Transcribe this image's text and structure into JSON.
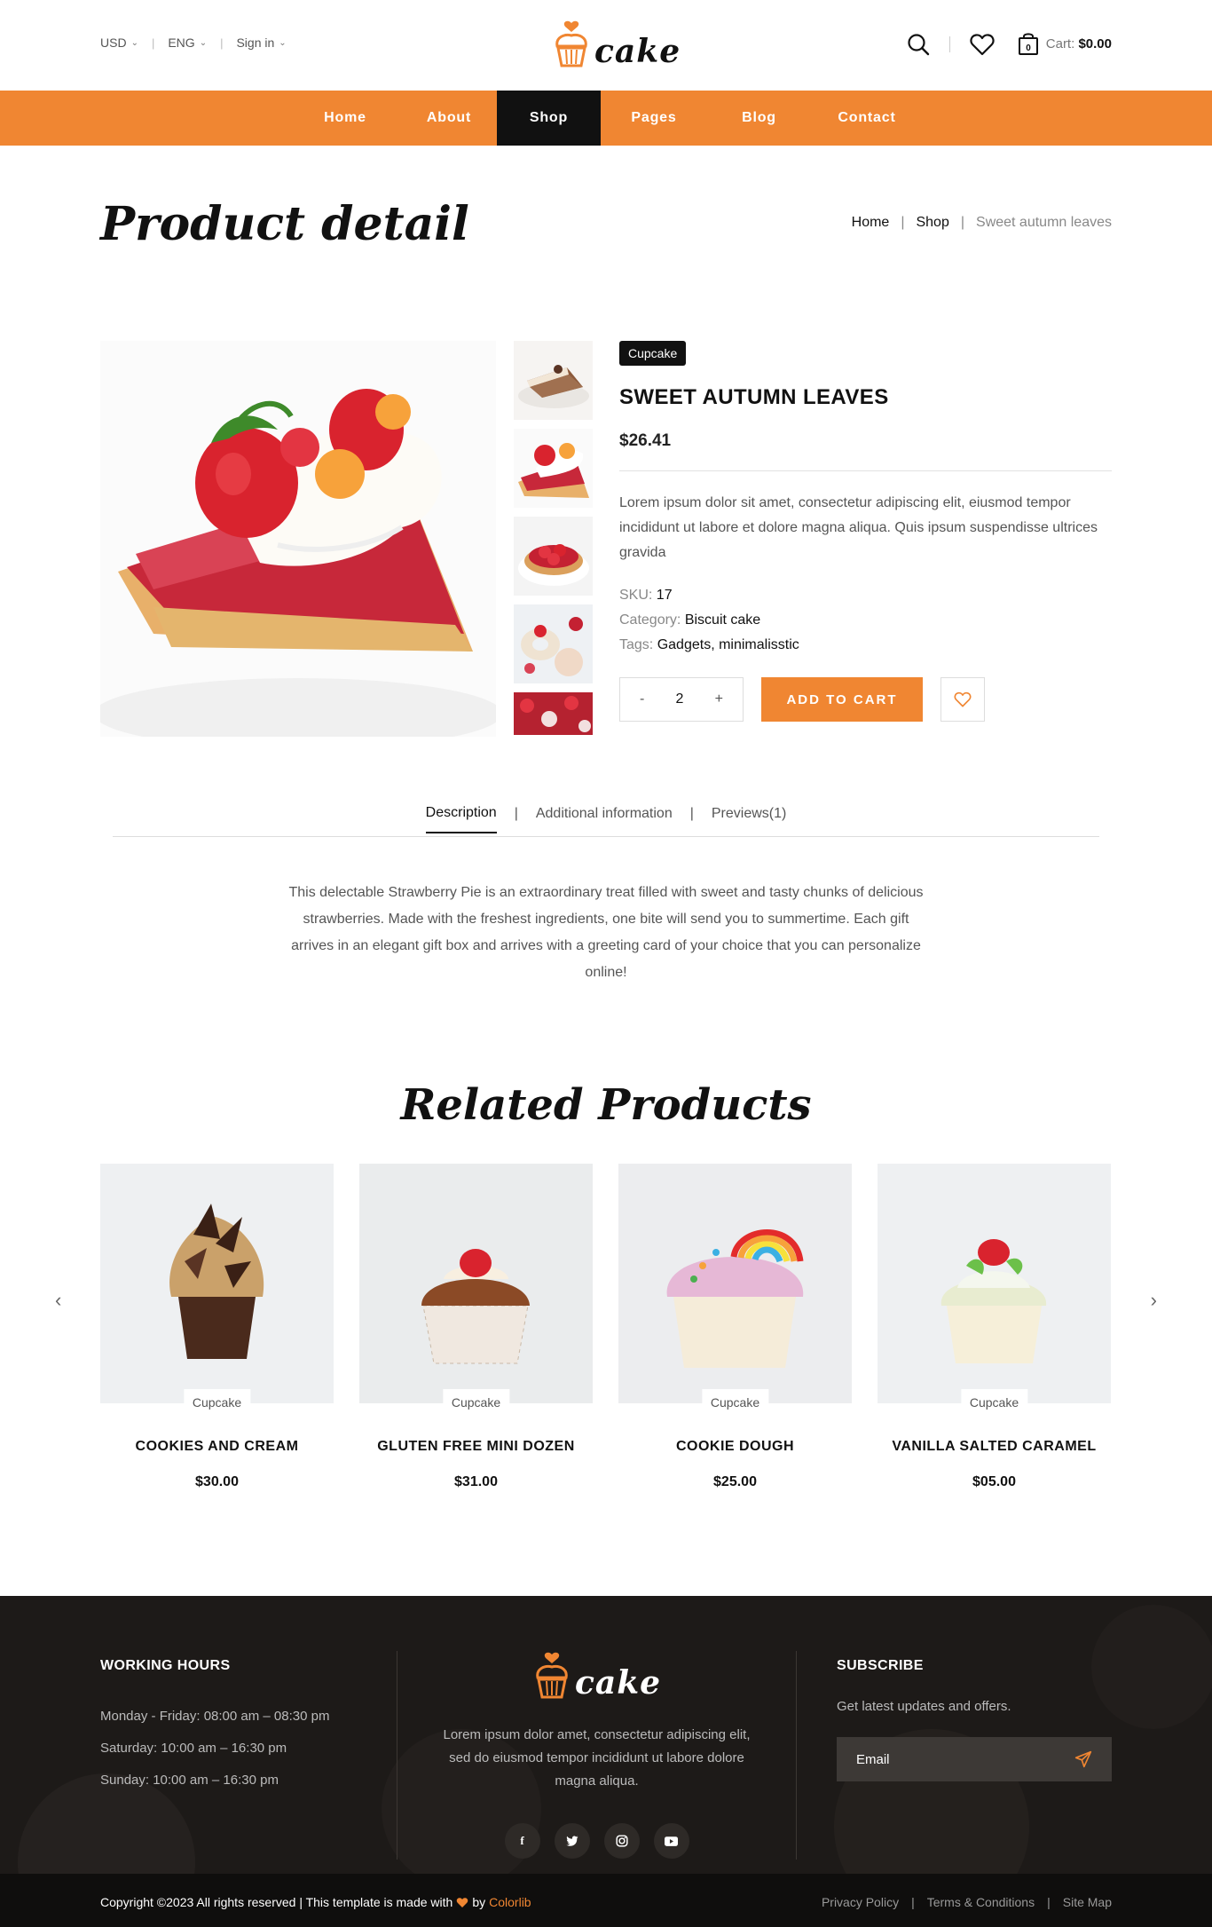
{
  "header": {
    "currency": "USD",
    "language": "ENG",
    "signin": "Sign in",
    "logo": "cake",
    "cart_label": "Cart:",
    "cart_total": "$0.00",
    "cart_count": "0"
  },
  "nav": {
    "items": [
      {
        "label": "Home",
        "width": 126,
        "active": false
      },
      {
        "label": "About",
        "width": 108,
        "active": false
      },
      {
        "label": "Shop",
        "width": 117,
        "active": true
      },
      {
        "label": "Pages",
        "width": 120,
        "active": false
      },
      {
        "label": "Blog",
        "width": 117,
        "active": false
      },
      {
        "label": "Contact",
        "width": 126,
        "active": false
      }
    ]
  },
  "page": {
    "title": "Product detail",
    "breadcrumb": [
      "Home",
      "Shop",
      "Sweet autumn leaves"
    ]
  },
  "product": {
    "tag": "Cupcake",
    "name": "SWEET AUTUMN LEAVES",
    "price": "$26.41",
    "description": "Lorem ipsum dolor sit amet, consectetur adipiscing elit, eiusmod tempor incididunt ut labore et dolore magna aliqua. Quis ipsum suspendisse ultrices gravida",
    "sku_label": "SKU:",
    "sku": "17",
    "category_label": "Category:",
    "category": "Biscuit cake",
    "tags_label": "Tags:",
    "tags": "Gadgets, minimalisstic",
    "qty_minus": "-",
    "qty": "2",
    "qty_plus": "+",
    "add_to_cart": "ADD TO CART"
  },
  "tabs": {
    "items": [
      "Description",
      "Additional information",
      "Previews(1)"
    ],
    "active": "Description",
    "content": "This delectable Strawberry Pie is an extraordinary treat filled with sweet and tasty chunks of delicious strawberries. Made with the freshest ingredients, one bite will send you to summertime. Each gift arrives in an elegant gift box and arrives with a greeting card of your choice that you can personalize online!"
  },
  "related": {
    "title": "Related Products",
    "products": [
      {
        "tag": "Cupcake",
        "name": "COOKIES AND CREAM",
        "price": "$30.00"
      },
      {
        "tag": "Cupcake",
        "name": "GLUTEN FREE MINI DOZEN",
        "price": "$31.00"
      },
      {
        "tag": "Cupcake",
        "name": "COOKIE DOUGH",
        "price": "$25.00"
      },
      {
        "tag": "Cupcake",
        "name": "VANILLA SALTED CARAMEL",
        "price": "$05.00"
      }
    ]
  },
  "footer": {
    "hours_title": "WORKING HOURS",
    "hours": [
      "Monday - Friday: 08:00 am – 08:30 pm",
      "Saturday: 10:00 am – 16:30 pm",
      "Sunday: 10:00 am – 16:30 pm"
    ],
    "logo": "cake",
    "about": "Lorem ipsum dolor amet, consectetur adipiscing elit, sed do eiusmod tempor incididunt ut labore dolore magna aliqua.",
    "subscribe_title": "SUBSCRIBE",
    "subscribe_text": "Get latest updates and offers.",
    "email_placeholder": "Email",
    "copyright": "Copyright ©2023 All rights reserved | This template is made with",
    "by": "by",
    "brand": "Colorlib",
    "links": [
      "Privacy Policy",
      "Terms & Conditions",
      "Site Map"
    ]
  },
  "colors": {
    "accent": "#f08632",
    "dark": "#111111",
    "footer": "#1d1a18"
  }
}
